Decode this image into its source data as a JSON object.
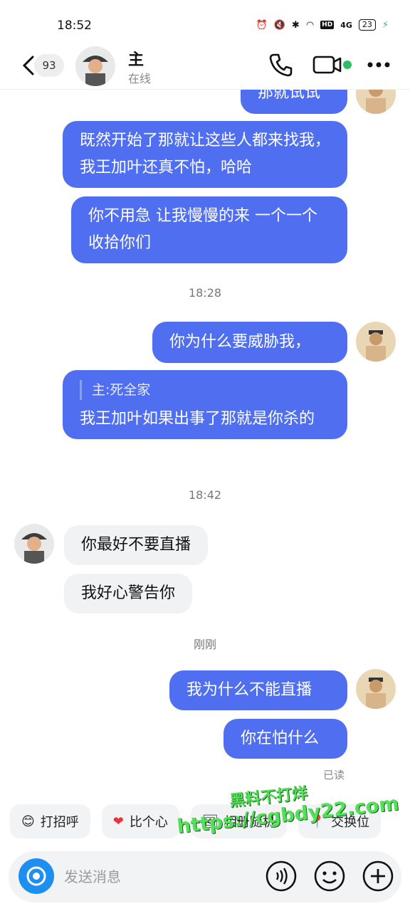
{
  "status_bar": {
    "time": "18:52",
    "network": "4G",
    "hd": "HD",
    "battery": "23"
  },
  "header": {
    "unread_count": "93",
    "contact_name": "主",
    "contact_status": "在线",
    "online_color": "#2fbf5f"
  },
  "messages": [
    {
      "side": "out",
      "text": "那就试试"
    },
    {
      "side": "out",
      "text": "既然开始了那就让这些人都来找我，我王加叶还真不怕，哈哈"
    },
    {
      "side": "out",
      "text": "你不用急 让我慢慢的来 一个一个收拾你们"
    },
    {
      "side": "time",
      "text": "18:28"
    },
    {
      "side": "out",
      "text": "你为什么要威胁我，"
    },
    {
      "side": "out",
      "quote": "主:死全家",
      "text": "我王加叶如果出事了那就是你杀的"
    },
    {
      "side": "time",
      "text": "18:42"
    },
    {
      "side": "in",
      "text": "你最好不要直播"
    },
    {
      "side": "in",
      "text": "我好心警告你"
    },
    {
      "side": "time",
      "text": "刚刚"
    },
    {
      "side": "out",
      "text": "我为什么不能直播"
    },
    {
      "side": "out",
      "text": "你在怕什么"
    }
  ],
  "read_status": "已读",
  "quick_actions": [
    {
      "label": "打招呼",
      "icon": "wave-emoji-icon"
    },
    {
      "label": "比个心",
      "icon": "heart-icon"
    },
    {
      "label": "相册随机",
      "icon": "photo-icon"
    },
    {
      "label": "交换位",
      "icon": "location-pin-icon"
    }
  ],
  "input": {
    "placeholder": "发送消息"
  },
  "watermark": {
    "line1": "黑料不打烊",
    "line2": "https://cgbdy22.com"
  },
  "colors": {
    "outgoing_bubble": "#4f6ff0",
    "incoming_bubble": "#f1f2f4",
    "camera_button": "#1f8ef1"
  }
}
